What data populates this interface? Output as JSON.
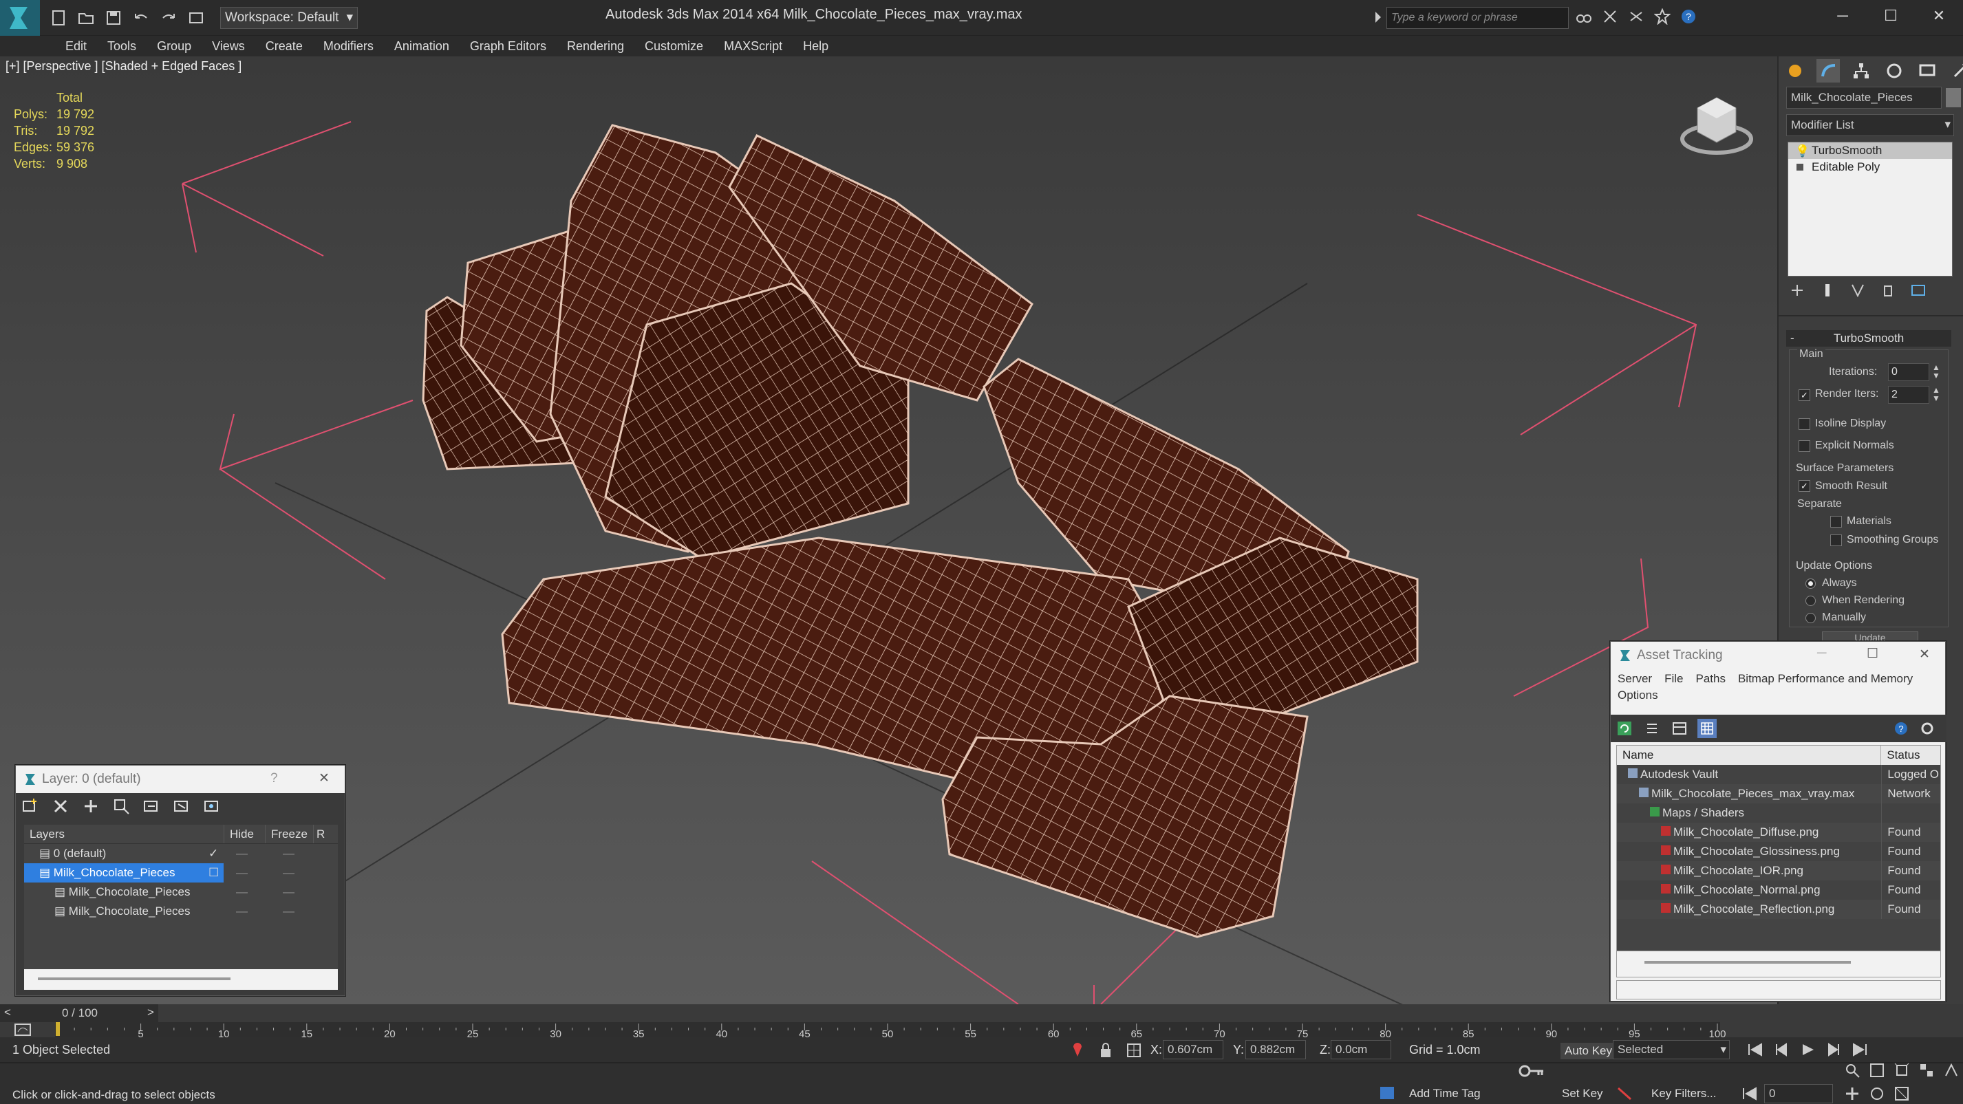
{
  "app": {
    "title": "Autodesk 3ds Max  2014 x64     Milk_Chocolate_Pieces_max_vray.max",
    "workspace": "Workspace: Default",
    "search_placeholder": "Type a keyword or phrase"
  },
  "menu": [
    "Edit",
    "Tools",
    "Group",
    "Views",
    "Create",
    "Modifiers",
    "Animation",
    "Graph Editors",
    "Rendering",
    "Customize",
    "MAXScript",
    "Help"
  ],
  "viewport": {
    "label": "[+] [Perspective ] [Shaded + Edged Faces ]",
    "stats_header": "Total",
    "stats": [
      {
        "label": "Polys:",
        "value": "19 792"
      },
      {
        "label": "Tris:",
        "value": "19 792"
      },
      {
        "label": "Edges:",
        "value": "59 376"
      },
      {
        "label": "Verts:",
        "value": "9 908"
      }
    ],
    "colors": {
      "wire": "#e8c9b8",
      "chocolate": "#4a1c10",
      "grid": "#e05070"
    }
  },
  "command_panel": {
    "object_name": "Milk_Chocolate_Pieces",
    "modifier_list": "Modifier List",
    "stack": [
      "TurboSmooth",
      "Editable Poly"
    ],
    "rollout_title": "TurboSmooth",
    "main_label": "Main",
    "iterations_label": "Iterations:",
    "iterations": "0",
    "render_iters_label": "Render Iters:",
    "render_iters": "2",
    "isoline": "Isoline Display",
    "explicit_normals": "Explicit Normals",
    "surface_params": "Surface Parameters",
    "smooth_result": "Smooth Result",
    "separate": "Separate",
    "materials": "Materials",
    "smoothing_groups": "Smoothing Groups",
    "update_options": "Update Options",
    "always": "Always",
    "when_rendering": "When Rendering",
    "manually": "Manually",
    "update_btn": "Update"
  },
  "layer_window": {
    "title": "Layer: 0 (default)",
    "help": "?",
    "columns": [
      "Layers",
      "Hide",
      "Freeze",
      "R"
    ],
    "rows": [
      {
        "name": "0 (default)",
        "indent": 1,
        "selected": false,
        "active": true
      },
      {
        "name": "Milk_Chocolate_Pieces",
        "indent": 1,
        "selected": true,
        "active": false
      },
      {
        "name": "Milk_Chocolate_Pieces",
        "indent": 2,
        "selected": false,
        "active": false
      },
      {
        "name": "Milk_Chocolate_Pieces",
        "indent": 2,
        "selected": false,
        "active": false
      }
    ]
  },
  "asset_tracking": {
    "title": "Asset Tracking",
    "menu": [
      "Server",
      "File",
      "Paths",
      "Bitmap Performance and Memory",
      "Options"
    ],
    "columns": [
      "Name",
      "Status"
    ],
    "rows": [
      {
        "name": "Autodesk Vault",
        "status": "Logged O",
        "indent": 1
      },
      {
        "name": "Milk_Chocolate_Pieces_max_vray.max",
        "status": "Network",
        "indent": 2
      },
      {
        "name": "Maps / Shaders",
        "status": "",
        "indent": 3
      },
      {
        "name": "Milk_Chocolate_Diffuse.png",
        "status": "Found",
        "indent": 4
      },
      {
        "name": "Milk_Chocolate_Glossiness.png",
        "status": "Found",
        "indent": 4
      },
      {
        "name": "Milk_Chocolate_IOR.png",
        "status": "Found",
        "indent": 4
      },
      {
        "name": "Milk_Chocolate_Normal.png",
        "status": "Found",
        "indent": 4
      },
      {
        "name": "Milk_Chocolate_Reflection.png",
        "status": "Found",
        "indent": 4
      }
    ]
  },
  "timeline": {
    "frame": "0 / 100",
    "ticks": [
      "0",
      "5",
      "10",
      "15",
      "20",
      "25",
      "30",
      "35",
      "40",
      "45",
      "50",
      "55",
      "60",
      "65",
      "70",
      "75",
      "80",
      "85",
      "90",
      "95",
      "100"
    ]
  },
  "status": {
    "selection": "1 Object Selected",
    "prompt": "Click or click-and-drag to select objects",
    "x_label": "X:",
    "x": "0.607cm",
    "y_label": "Y:",
    "y": "0.882cm",
    "z_label": "Z:",
    "z": "0.0cm",
    "grid": "Grid = 1.0cm",
    "add_time_tag": "Add Time Tag",
    "auto_key": "Auto Key",
    "set_key": "Set Key",
    "selected": "Selected",
    "key_filters": "Key Filters...",
    "frame_value": "0"
  }
}
